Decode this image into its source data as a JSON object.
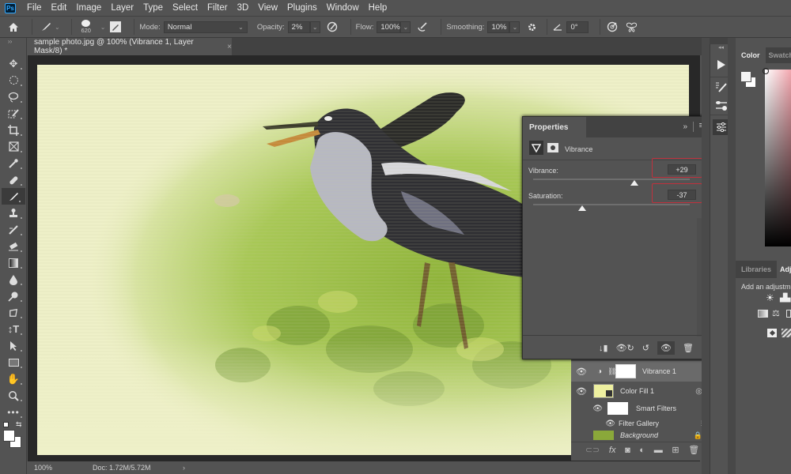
{
  "app": {
    "logo": "Ps"
  },
  "menu": [
    "File",
    "Edit",
    "Image",
    "Layer",
    "Type",
    "Select",
    "Filter",
    "3D",
    "View",
    "Plugins",
    "Window",
    "Help"
  ],
  "options": {
    "brush_size": "620",
    "mode_label": "Mode:",
    "mode_value": "Normal",
    "opacity_label": "Opacity:",
    "opacity_value": "2%",
    "flow_label": "Flow:",
    "flow_value": "100%",
    "smoothing_label": "Smoothing:",
    "smoothing_value": "10%",
    "angle_value": "0°"
  },
  "document": {
    "tab_title": "sample photo.jpg @ 100% (Vibrance 1, Layer Mask/8) *",
    "zoom": "100%",
    "doc_info": "Doc: 1.72M/5.72M"
  },
  "properties": {
    "title": "Properties",
    "adjustment_name": "Vibrance",
    "vibrance_label": "Vibrance:",
    "vibrance_value": "+29",
    "vibrance_fraction": 0.645,
    "saturation_label": "Saturation:",
    "saturation_value": "-37",
    "saturation_fraction": 0.315,
    "highlight_color": "#c0313d"
  },
  "layers": {
    "items": [
      {
        "name": "Vibrance 1",
        "type": "adjustment",
        "selected": true
      },
      {
        "name": "Color Fill 1",
        "type": "smart-object"
      },
      {
        "name": "Smart Filters",
        "type": "smart-filters"
      },
      {
        "name": "Filter Gallery",
        "type": "filter"
      },
      {
        "name": "Background",
        "type": "image"
      }
    ]
  },
  "panels": {
    "color_tab": "Color",
    "swatches_tab": "Swatch",
    "libraries_tab": "Libraries",
    "adjustments_tab": "Adj",
    "adjustments_hint": "Add an adjustmen"
  }
}
